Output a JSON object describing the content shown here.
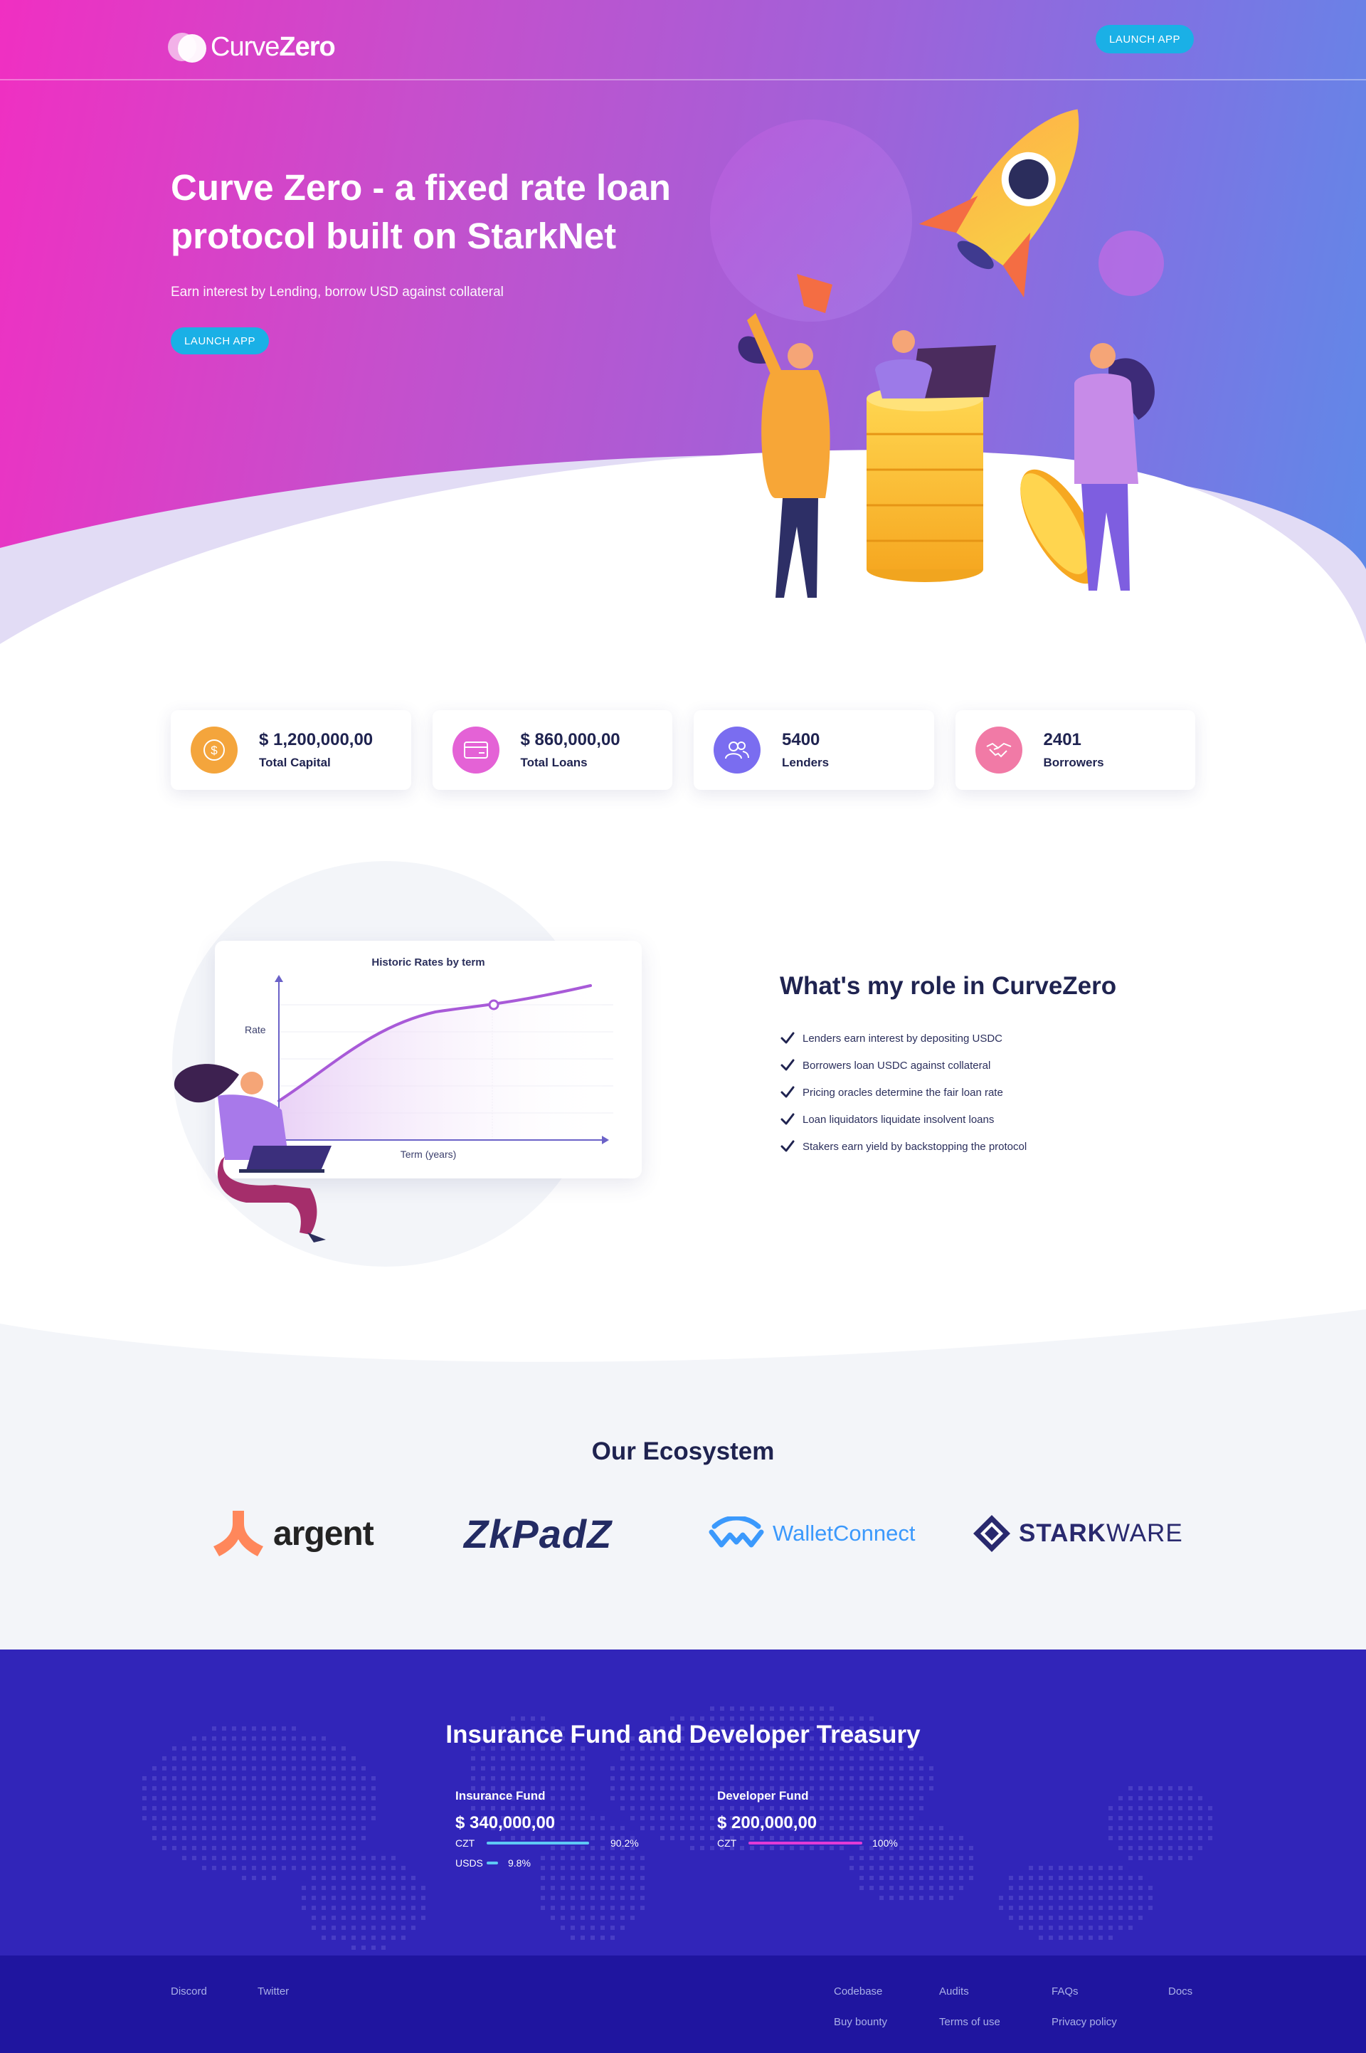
{
  "header": {
    "logo_light": "Curve",
    "logo_bold": "Zero",
    "launch_label": "LAUNCH APP"
  },
  "hero": {
    "title": "Curve Zero - a fixed rate loan protocol built on StarkNet",
    "subtitle": "Earn interest by Lending, borrow USD against collateral",
    "launch_label": "LAUNCH APP"
  },
  "stats": [
    {
      "value": "$ 1,200,000,00",
      "label": "Total Capital",
      "icon": "dollar-icon",
      "color": "#f4a53c"
    },
    {
      "value": "$ 860,000,00",
      "label": "Total Loans",
      "icon": "wallet-icon",
      "color": "#e462d6"
    },
    {
      "value": "5400",
      "label": "Lenders",
      "icon": "users-icon",
      "color": "#7a6df0"
    },
    {
      "value": "2401",
      "label": "Borrowers",
      "icon": "handshake-icon",
      "color": "#f17aa6"
    }
  ],
  "role": {
    "chart_title": "Historic Rates by term",
    "y_label": "Rate",
    "x_label": "Term (years)",
    "title": "What's my role in CurveZero",
    "items": [
      "Lenders earn interest by depositing USDC",
      "Borrowers loan USDC against collateral",
      "Pricing oracles determine the fair loan rate",
      "Loan liquidators liquidate insolvent loans",
      "Stakers earn yield by backstopping the protocol"
    ]
  },
  "ecosystem": {
    "title": "Our Ecosystem",
    "partners": {
      "argent": "argent",
      "zkpad": "ZkPadZ",
      "walletconnect": "WalletConnect",
      "starkware_bold": "STARK",
      "starkware_light": "WARE"
    }
  },
  "insurance": {
    "title": "Insurance Fund and Developer Treasury",
    "funds": [
      {
        "label": "Insurance Fund",
        "value": "$ 340,000,00",
        "rows": [
          {
            "name": "CZT",
            "pct_label": "90.2%",
            "fraction": 0.902,
            "color": "#5fc8f5"
          },
          {
            "name": "USDS",
            "pct_label": "9.8%",
            "fraction": 0.098,
            "color": "#5fc8f5"
          }
        ]
      },
      {
        "label": "Developer Fund",
        "value": "$ 200,000,00",
        "rows": [
          {
            "name": "CZT",
            "pct_label": "100%",
            "fraction": 1.0,
            "color": "#e23ad6"
          }
        ]
      }
    ]
  },
  "footer": {
    "discord": "Discord",
    "twitter": "Twitter",
    "codebase": "Codebase",
    "audits": "Audits",
    "faqs": "FAQs",
    "docs": "Docs",
    "bounty": "Buy bounty",
    "terms": "Terms of use",
    "privacy": "Privacy policy"
  }
}
